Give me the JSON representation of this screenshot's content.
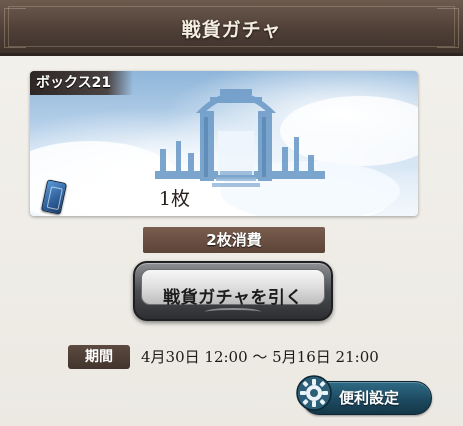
{
  "header": {
    "title": "戦貨ガチャ"
  },
  "box": {
    "label": "ボックス21",
    "ticket_count": "1枚",
    "ticket_icon": "ticket-icon"
  },
  "cost": {
    "label": "2枚消費"
  },
  "draw_button": {
    "label": "戦貨ガチャを引く"
  },
  "period": {
    "label": "期間",
    "range": "4月30日 12:00 〜 5月16日 21:00"
  },
  "settings_button": {
    "label": "便利設定",
    "icon": "gear-icon"
  },
  "colors": {
    "header": "#4f4037",
    "accent_brown": "#5b4438",
    "settings_teal": "#1d4a61"
  }
}
